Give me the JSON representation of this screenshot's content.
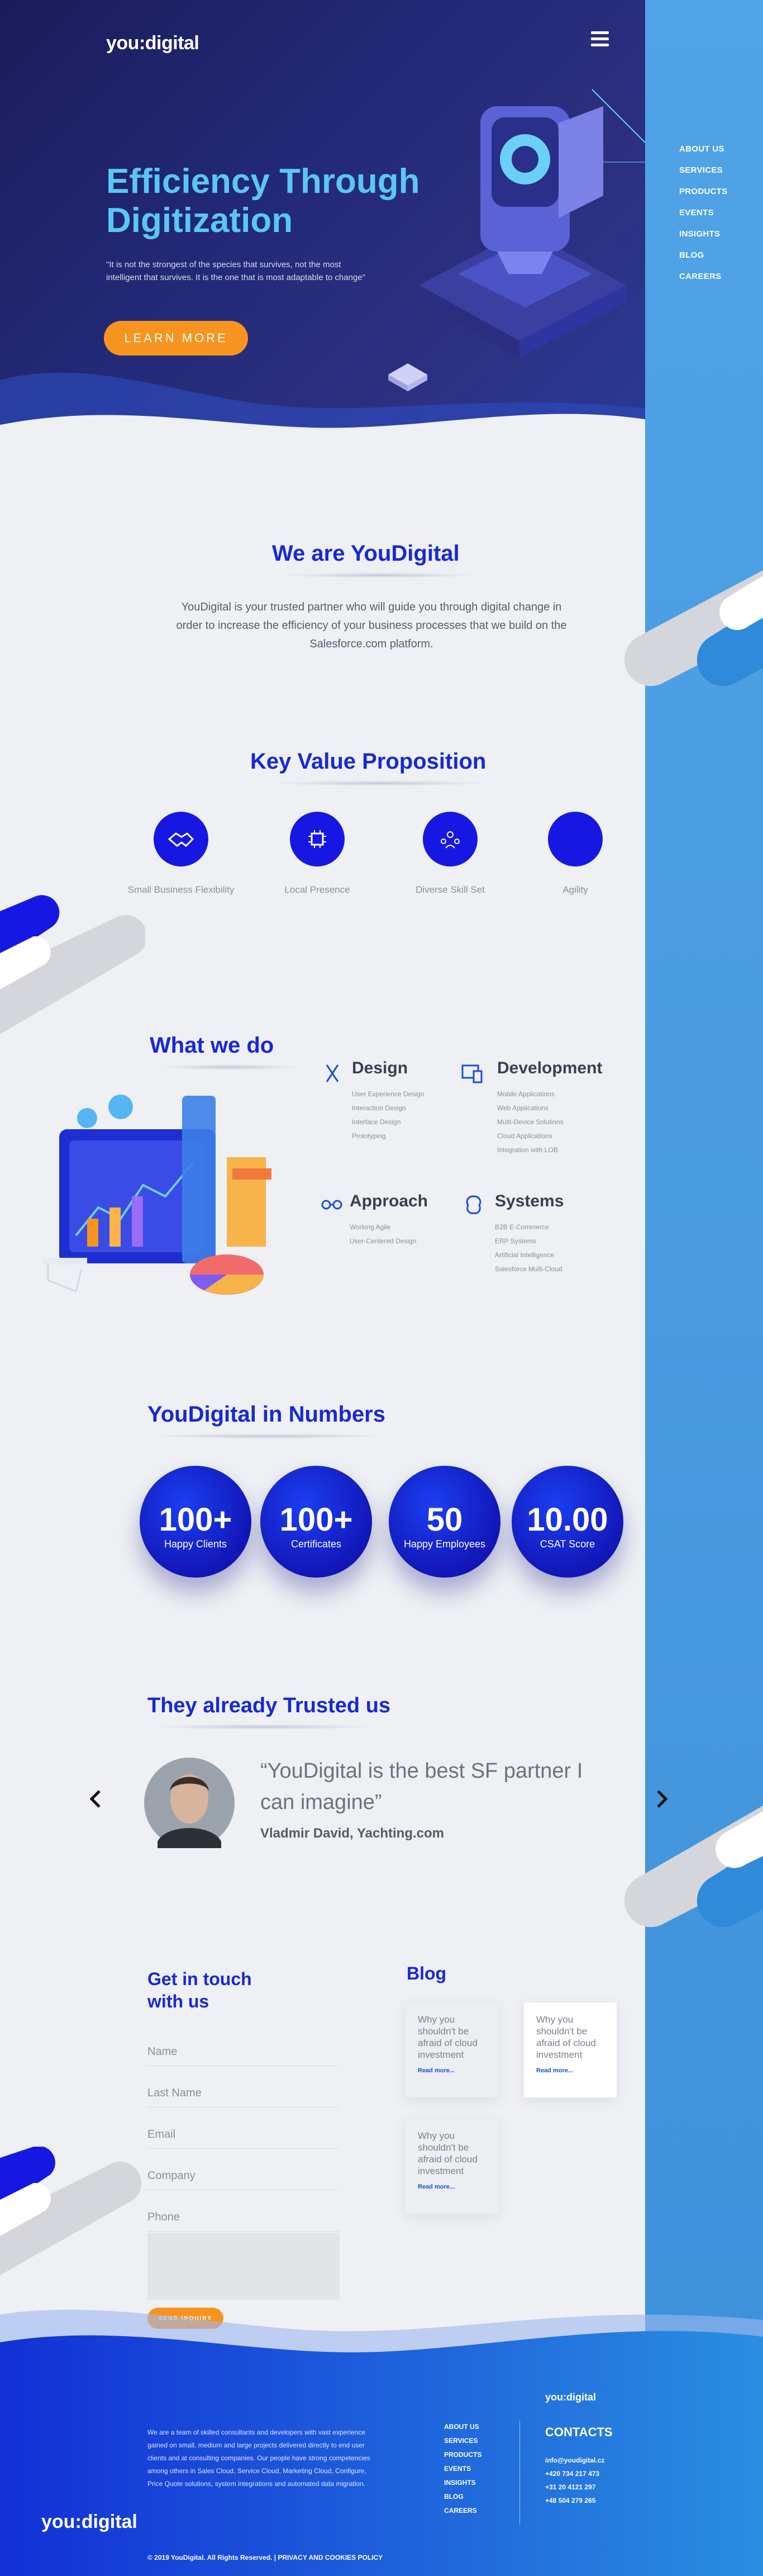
{
  "brand": {
    "logo": "you:digital"
  },
  "nav": {
    "items": [
      "ABOUT US",
      "SERVICES",
      "PRODUCTS",
      "EVENTS",
      "INSIGHTS",
      "BLOG",
      "CAREERS"
    ]
  },
  "hero": {
    "title": "Efficiency Through Digitization",
    "quote": "\"It is not the strongest of the species that survives, not the most intelligent that survives. It is the one that is most adaptable to change\"",
    "button": "LEARN MORE"
  },
  "about": {
    "title": "We are YouDigital",
    "text": "YouDigital is your trusted partner who will guide you through digital change in order to increase the efficiency of your business processes that we build on the Salesforce.com platform."
  },
  "kvp": {
    "title": "Key Value Proposition",
    "items": [
      {
        "label": "Small Business Flexibility",
        "icon": "handshake-icon"
      },
      {
        "label": "Local Presence",
        "icon": "chip-icon"
      },
      {
        "label": "Diverse Skill Set",
        "icon": "team-icon"
      },
      {
        "label": "Agility",
        "icon": "agility-icon"
      }
    ]
  },
  "services": {
    "title": "What we do",
    "design": {
      "title": "Design",
      "items": [
        "User Experience Design",
        "Interaction Design",
        "Interface Design",
        "Prototyping"
      ]
    },
    "development": {
      "title": "Development",
      "items": [
        "Mobile Applications",
        "Web Applications",
        "Multi-Device Solutions",
        "Cloud Applications",
        "Integration with LOB"
      ]
    },
    "approach": {
      "title": "Approach",
      "items": [
        "Working Agile",
        "User-Centered Design"
      ]
    },
    "systems": {
      "title": "Systems",
      "items": [
        "B2B E-Commerce",
        "ERP Systems",
        "Artificial Intelligence",
        "Salesforce Multi-Cloud"
      ]
    }
  },
  "numbers": {
    "title": "YouDigital in Numbers",
    "items": [
      {
        "value": "100+",
        "label": "Happy Clients"
      },
      {
        "value": "100+",
        "label": "Certificates"
      },
      {
        "value": "50",
        "label": "Happy Employees"
      },
      {
        "value": "10.00",
        "label": "CSAT Score"
      }
    ]
  },
  "testimonials": {
    "title": "They already Trusted us",
    "quote": "“YouDigital is the best SF partner I can imagine”",
    "author": "Vladmir David, Yachting.com"
  },
  "contact": {
    "title": "Get in touch with us",
    "fields": {
      "name": "Name",
      "last_name": "Last Name",
      "email": "Email",
      "company": "Company",
      "phone": "Phone"
    },
    "button": "SEND INQUIRY"
  },
  "blog": {
    "title": "Blog",
    "cards": [
      {
        "text": "Why you shouldn't be afraid of cloud investment",
        "link": "Read more..."
      },
      {
        "text": "Why you shouldn't be afraid of cloud investment",
        "link": "Read more..."
      },
      {
        "text": "Why you shouldn't be afraid of cloud investment",
        "link": "Read more..."
      }
    ]
  },
  "footer": {
    "about": "We are a team of skilled consultants and developers with vast experience gained on small, medium and large projects delivered directly to end user clients and at consulting companies. Our people have strong competencies among others in Sales Cloud, Service Cloud, Marketing Cloud, Configure, Price Quote solutions, system integrations and automated data migration.",
    "nav": [
      "ABOUT US",
      "SERVICES",
      "PRODUCTS",
      "EVENTS",
      "INSIGHTS",
      "BLOG",
      "CAREERS"
    ],
    "contacts_title": "CONTACTS",
    "contacts": [
      "info@youdigital.cz",
      "+420 734 217 473",
      "+31 20 4121 297",
      "+48 504 279 265"
    ],
    "copyright": "© 2019 YouDigital. All Rights Reserved. | PRIVACY AND COOKIES POLICY"
  },
  "colors": {
    "primary": "#1728d8",
    "accent": "#f7941f",
    "rail": "#4a9be0",
    "hero": "#232a78"
  }
}
